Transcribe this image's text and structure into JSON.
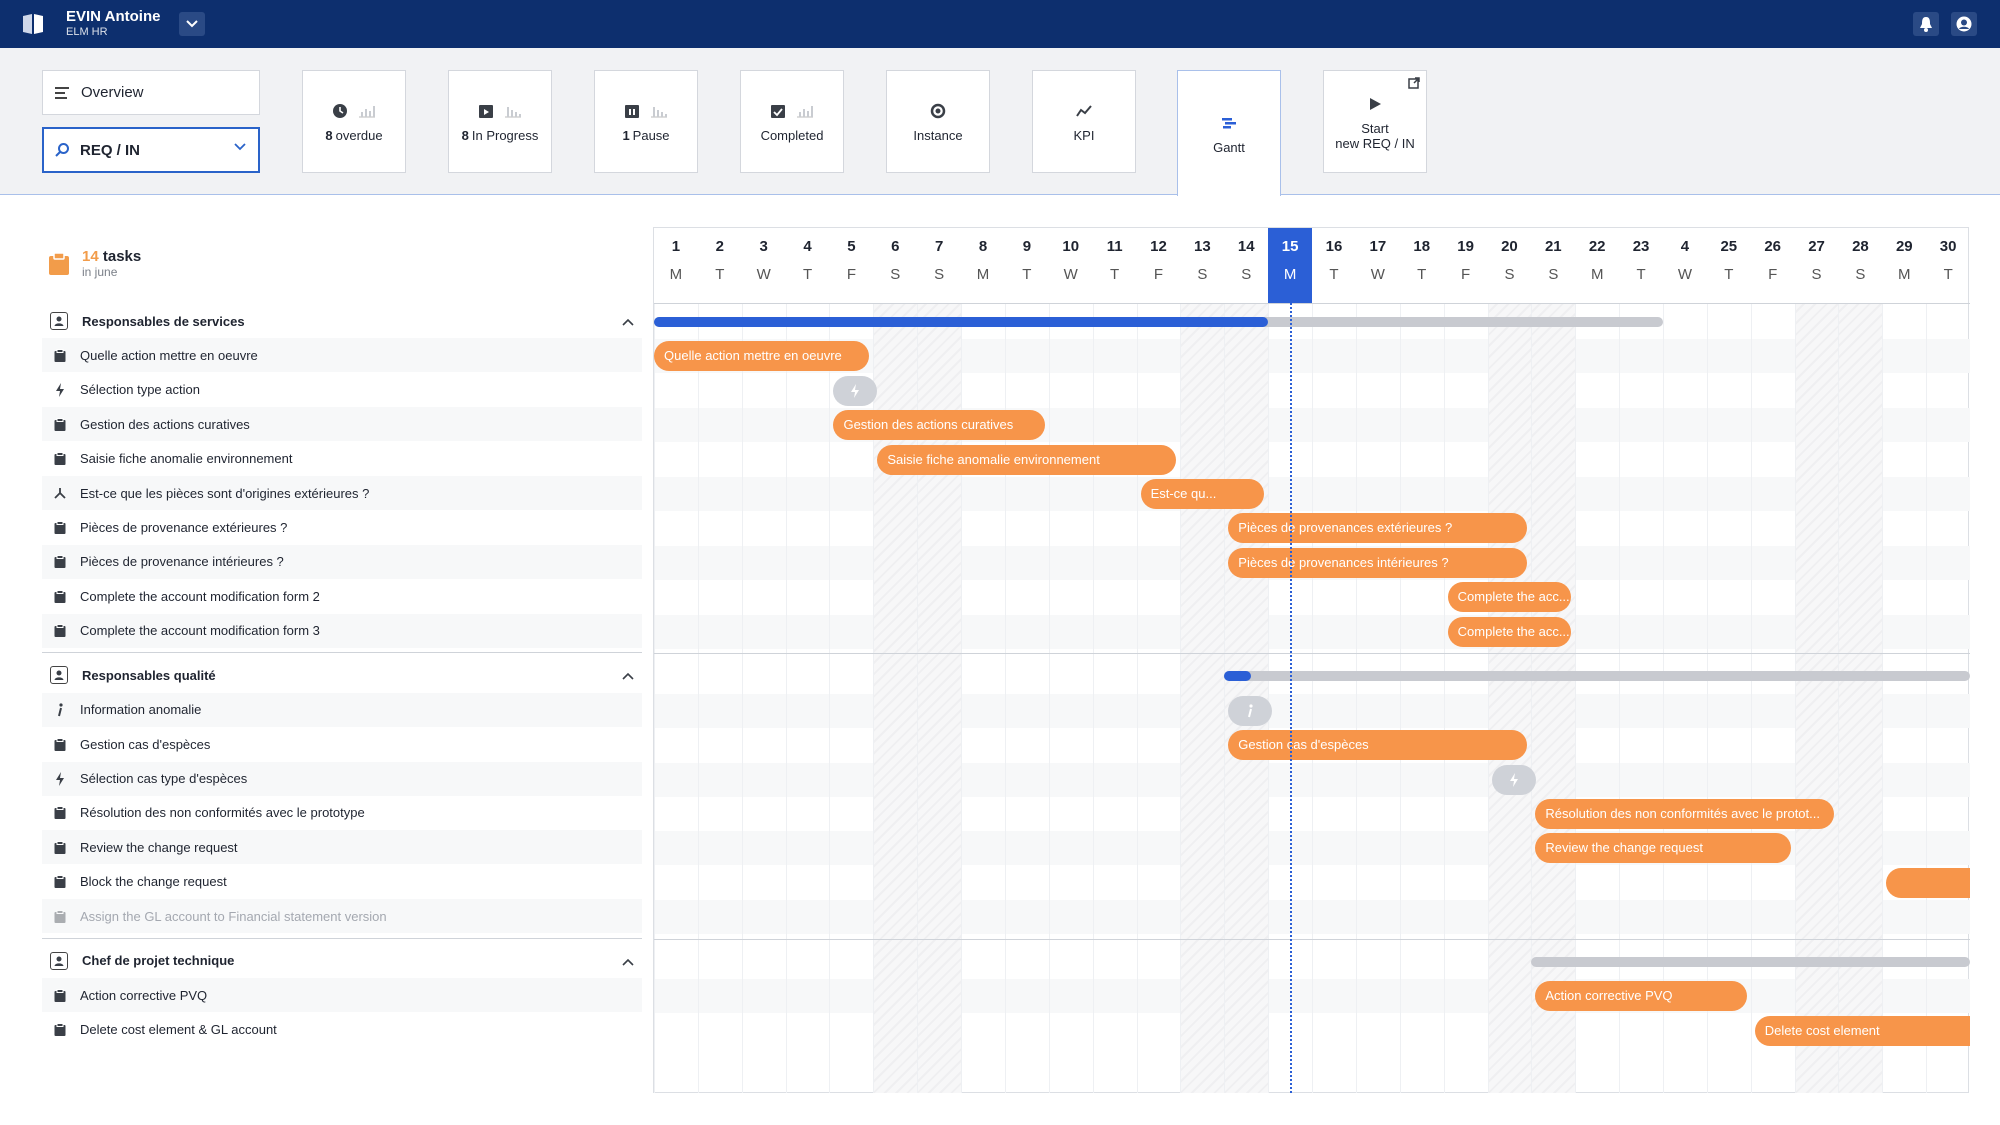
{
  "topbar": {
    "user_name": "EVIN Antoine",
    "user_org": "ELM HR",
    "icons": [
      "app-logo-icon",
      "chevron-down-icon",
      "bell-icon",
      "user-icon"
    ]
  },
  "toolbar": {
    "overview_label": "Overview",
    "select_value": "REQ / IN",
    "tiles": [
      {
        "num": "8",
        "label": "overdue",
        "icon": "clock-icon"
      },
      {
        "num": "8",
        "label": "In Progress",
        "icon": "calendar-play-icon"
      },
      {
        "num": "1",
        "label": "Pause",
        "icon": "calendar-pause-icon"
      },
      {
        "num": "",
        "label": "Completed",
        "icon": "calendar-check-icon"
      },
      {
        "num": "",
        "label": "Instance",
        "icon": "gear-icon"
      },
      {
        "num": "",
        "label": "KPI",
        "icon": "trend-icon"
      },
      {
        "num": "",
        "label": "Gantt",
        "icon": "gantt-icon"
      },
      {
        "num": "",
        "label": "Start\nnew REQ / IN",
        "icon": "play-icon"
      }
    ]
  },
  "gantt": {
    "task_count": "14",
    "task_word": "tasks",
    "period": "in june",
    "today": 15,
    "days": [
      {
        "n": "1",
        "w": "M"
      },
      {
        "n": "2",
        "w": "T"
      },
      {
        "n": "3",
        "w": "W"
      },
      {
        "n": "4",
        "w": "T"
      },
      {
        "n": "5",
        "w": "F"
      },
      {
        "n": "6",
        "w": "S"
      },
      {
        "n": "7",
        "w": "S"
      },
      {
        "n": "8",
        "w": "M"
      },
      {
        "n": "9",
        "w": "T"
      },
      {
        "n": "10",
        "w": "W"
      },
      {
        "n": "11",
        "w": "T"
      },
      {
        "n": "12",
        "w": "F"
      },
      {
        "n": "13",
        "w": "S"
      },
      {
        "n": "14",
        "w": "S"
      },
      {
        "n": "15",
        "w": "M"
      },
      {
        "n": "16",
        "w": "T"
      },
      {
        "n": "17",
        "w": "W"
      },
      {
        "n": "18",
        "w": "T"
      },
      {
        "n": "19",
        "w": "F"
      },
      {
        "n": "20",
        "w": "S"
      },
      {
        "n": "21",
        "w": "S"
      },
      {
        "n": "22",
        "w": "M"
      },
      {
        "n": "23",
        "w": "T"
      },
      {
        "n": "4",
        "w": "W"
      },
      {
        "n": "25",
        "w": "T"
      },
      {
        "n": "26",
        "w": "F"
      },
      {
        "n": "27",
        "w": "S"
      },
      {
        "n": "28",
        "w": "S"
      },
      {
        "n": "29",
        "w": "M"
      },
      {
        "n": "30",
        "w": "T"
      }
    ],
    "groups": [
      {
        "name": "Responsables de services",
        "summary": {
          "start": 1,
          "end": 23,
          "progress_until": 15
        },
        "tasks": [
          {
            "label": "Quelle action mettre en oeuvre",
            "type": "task",
            "bar": {
              "start": 1,
              "end": 5,
              "text": "Quelle action mettre en oeuvre"
            }
          },
          {
            "label": "Sélection type action",
            "type": "auto",
            "bar": {
              "start": 5,
              "end": 6,
              "text": "",
              "pill": true
            }
          },
          {
            "label": "Gestion des actions curatives",
            "type": "task",
            "bar": {
              "start": 5,
              "end": 9,
              "text": "Gestion des actions curatives"
            }
          },
          {
            "label": "Saisie fiche anomalie environnement",
            "type": "task",
            "bar": {
              "start": 6,
              "end": 12,
              "text": "Saisie fiche anomalie environnement"
            }
          },
          {
            "label": "Est-ce que les pièces sont d'origines extérieures ?",
            "type": "gateway",
            "bar": {
              "start": 12,
              "end": 14,
              "text": "Est-ce qu..."
            }
          },
          {
            "label": "Pièces de provenance extérieures ?",
            "type": "task",
            "bar": {
              "start": 14,
              "end": 20,
              "text": "Pièces de provenances extérieures ?"
            }
          },
          {
            "label": "Pièces de provenance intérieures ?",
            "type": "task",
            "bar": {
              "start": 14,
              "end": 20,
              "text": "Pièces de provenances intérieures ?"
            }
          },
          {
            "label": "Complete the account modification form 2",
            "type": "task",
            "bar": {
              "start": 19,
              "end": 21,
              "text": "Complete the acc..."
            }
          },
          {
            "label": "Complete the account modification form 3",
            "type": "task",
            "bar": {
              "start": 19,
              "end": 21,
              "text": "Complete the acc..."
            }
          }
        ]
      },
      {
        "name": "Responsables qualité",
        "summary": {
          "start": 14,
          "end": 30,
          "progress_until": 14.6
        },
        "tasks": [
          {
            "label": "Information anomalie",
            "type": "info",
            "bar": {
              "start": 14,
              "end": 15,
              "text": "",
              "pill": true,
              "pill_icon": "i"
            }
          },
          {
            "label": "Gestion cas d'espèces",
            "type": "task",
            "bar": {
              "start": 14,
              "end": 20,
              "text": "Gestion cas d'espèces"
            }
          },
          {
            "label": "Sélection cas type d'espèces",
            "type": "auto",
            "bar": {
              "start": 20,
              "end": 21,
              "text": "",
              "pill": true
            }
          },
          {
            "label": "Résolution des non conformités avec le prototype",
            "type": "task",
            "bar": {
              "start": 21,
              "end": 27,
              "text": "Résolution des non conformités avec le protot..."
            }
          },
          {
            "label": "Review the change request",
            "type": "task",
            "bar": {
              "start": 21,
              "end": 26,
              "text": "Review the change request"
            }
          },
          {
            "label": "Block the change request",
            "type": "task",
            "bar": {
              "start": 29,
              "end": 30,
              "text": ""
            }
          },
          {
            "label": "Assign the GL account to Financial statement version",
            "type": "task",
            "muted": true
          }
        ]
      },
      {
        "name": "Chef de projet technique",
        "summary": {
          "start": 21,
          "end": 30,
          "progress_until": 21
        },
        "tasks": [
          {
            "label": "Action corrective PVQ",
            "type": "task",
            "bar": {
              "start": 21,
              "end": 25,
              "text": "Action corrective PVQ"
            }
          },
          {
            "label": "Delete cost element & GL account",
            "type": "task",
            "bar": {
              "start": 26,
              "end": 30,
              "text": "Delete cost element"
            }
          }
        ]
      }
    ]
  }
}
